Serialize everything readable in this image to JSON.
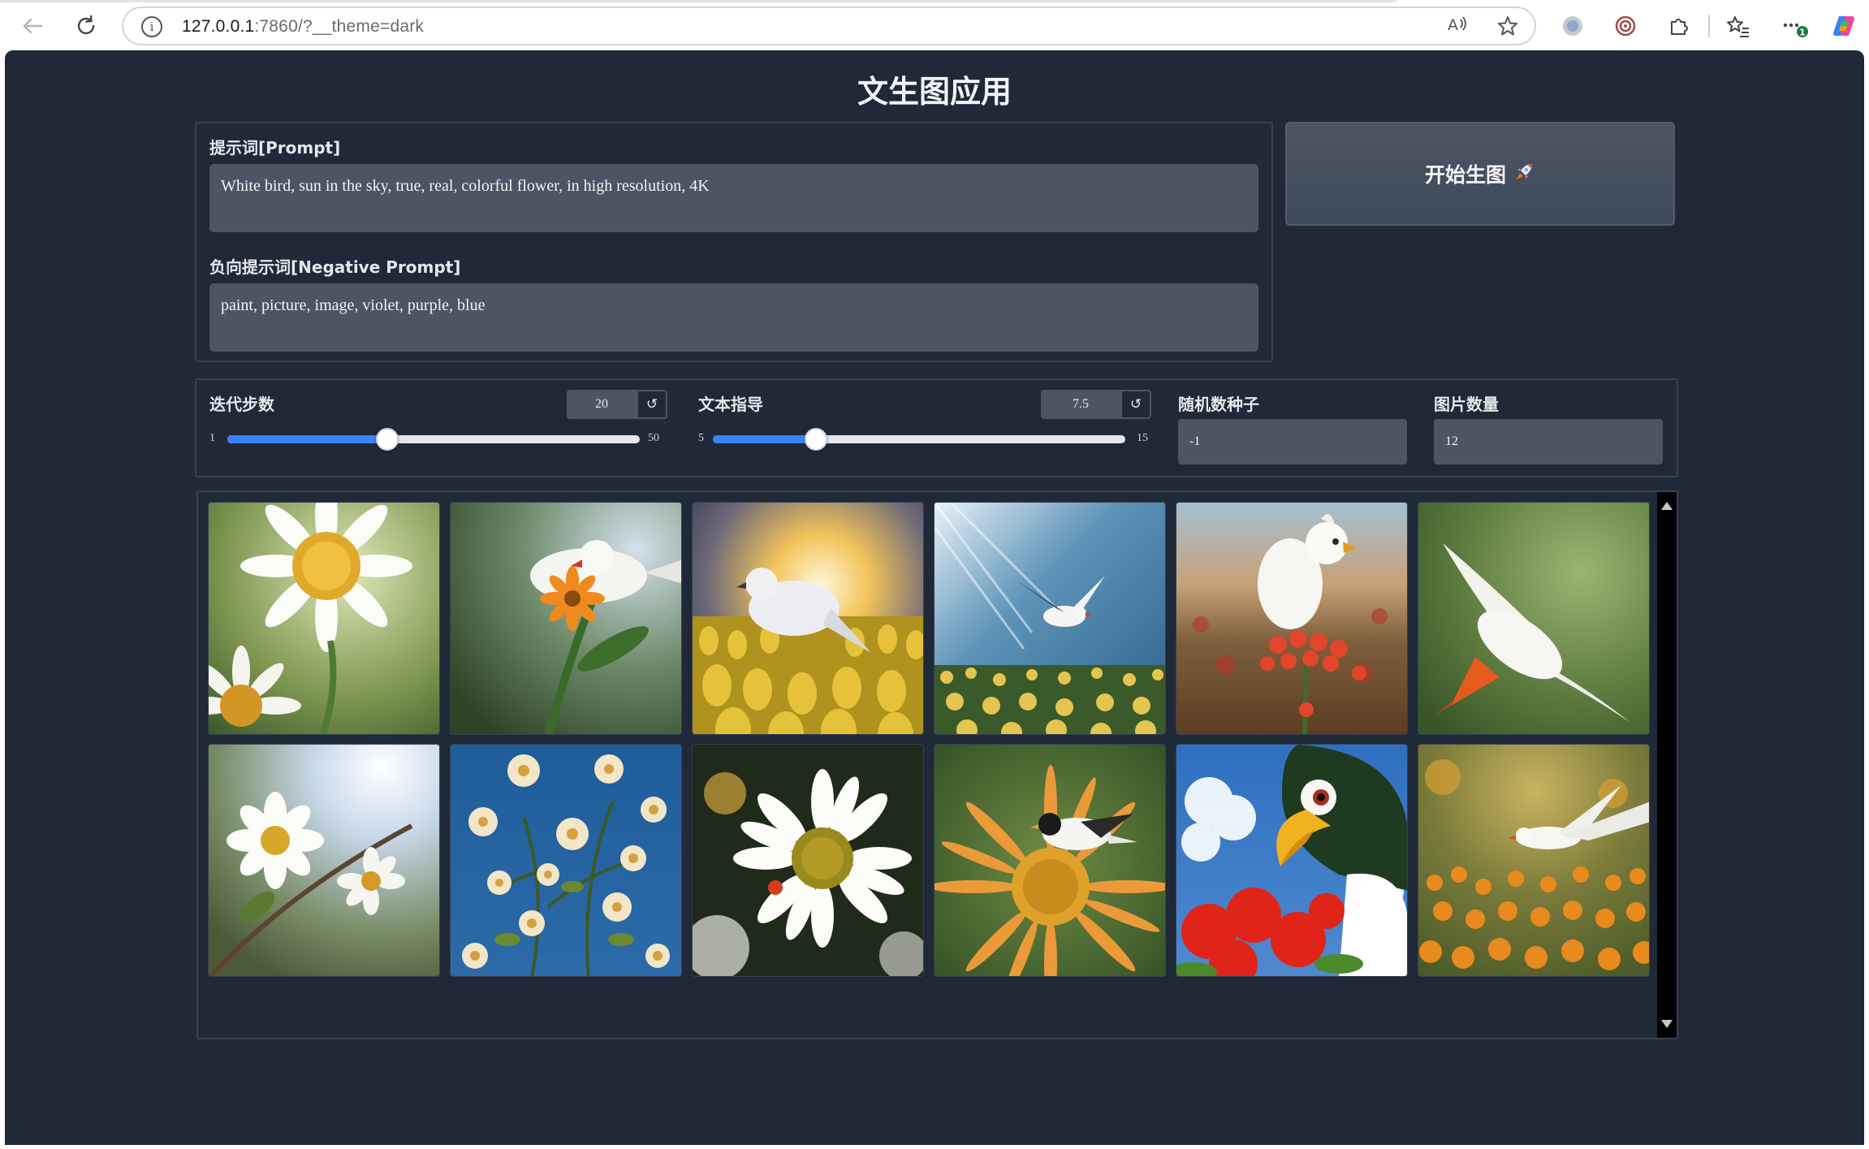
{
  "browser": {
    "url_host": "127.0.0.1",
    "url_rest": ":7860/?__theme=dark",
    "icons": [
      "back-arrow-icon",
      "reload-icon",
      "site-info-icon",
      "read-aloud-icon",
      "favorite-star-icon",
      "extension-circle-icon",
      "target-extension-icon",
      "puzzle-extensions-icon",
      "favorites-list-icon",
      "more-menu-icon",
      "copilot-icon"
    ],
    "more_badge": "1"
  },
  "app": {
    "title": "文生图应用",
    "prompt": {
      "label": "提示词[Prompt]",
      "value": "White bird, sun in the sky, true, real, colorful flower, in high resolution, 4K"
    },
    "negative_prompt": {
      "label": "负向提示词[Negative Prompt]",
      "value": "paint, picture, image, violet, purple, blue"
    },
    "generate_button": {
      "label": "开始生图",
      "icon": "rocket-icon"
    },
    "steps": {
      "label": "迭代步数",
      "value": "20",
      "min": "1",
      "max": "50",
      "level": 20,
      "range": [
        1,
        50
      ],
      "reset_icon": "reset-icon"
    },
    "guidance": {
      "label": "文本指导",
      "value": "7.5",
      "min": "5",
      "max": "15",
      "level": 7.5,
      "range": [
        5,
        15
      ],
      "reset_icon": "reset-icon"
    },
    "seed": {
      "label": "随机数种子",
      "value": "-1"
    },
    "num_images": {
      "label": "图片数量",
      "value": "12"
    },
    "gallery": {
      "images": [
        "daisies-close-up",
        "white-bird-orange-flower",
        "white-bird-sunset-field",
        "white-bird-flying-over-flowers",
        "white-parrot-red-flowers",
        "white-bird-flying-green",
        "white-flowers-sunlight",
        "daisies-blue-sky",
        "single-daisy-dark",
        "bird-on-orange-sunflower",
        "toucan-red-flower",
        "white-bird-orange-flowers"
      ]
    }
  }
}
